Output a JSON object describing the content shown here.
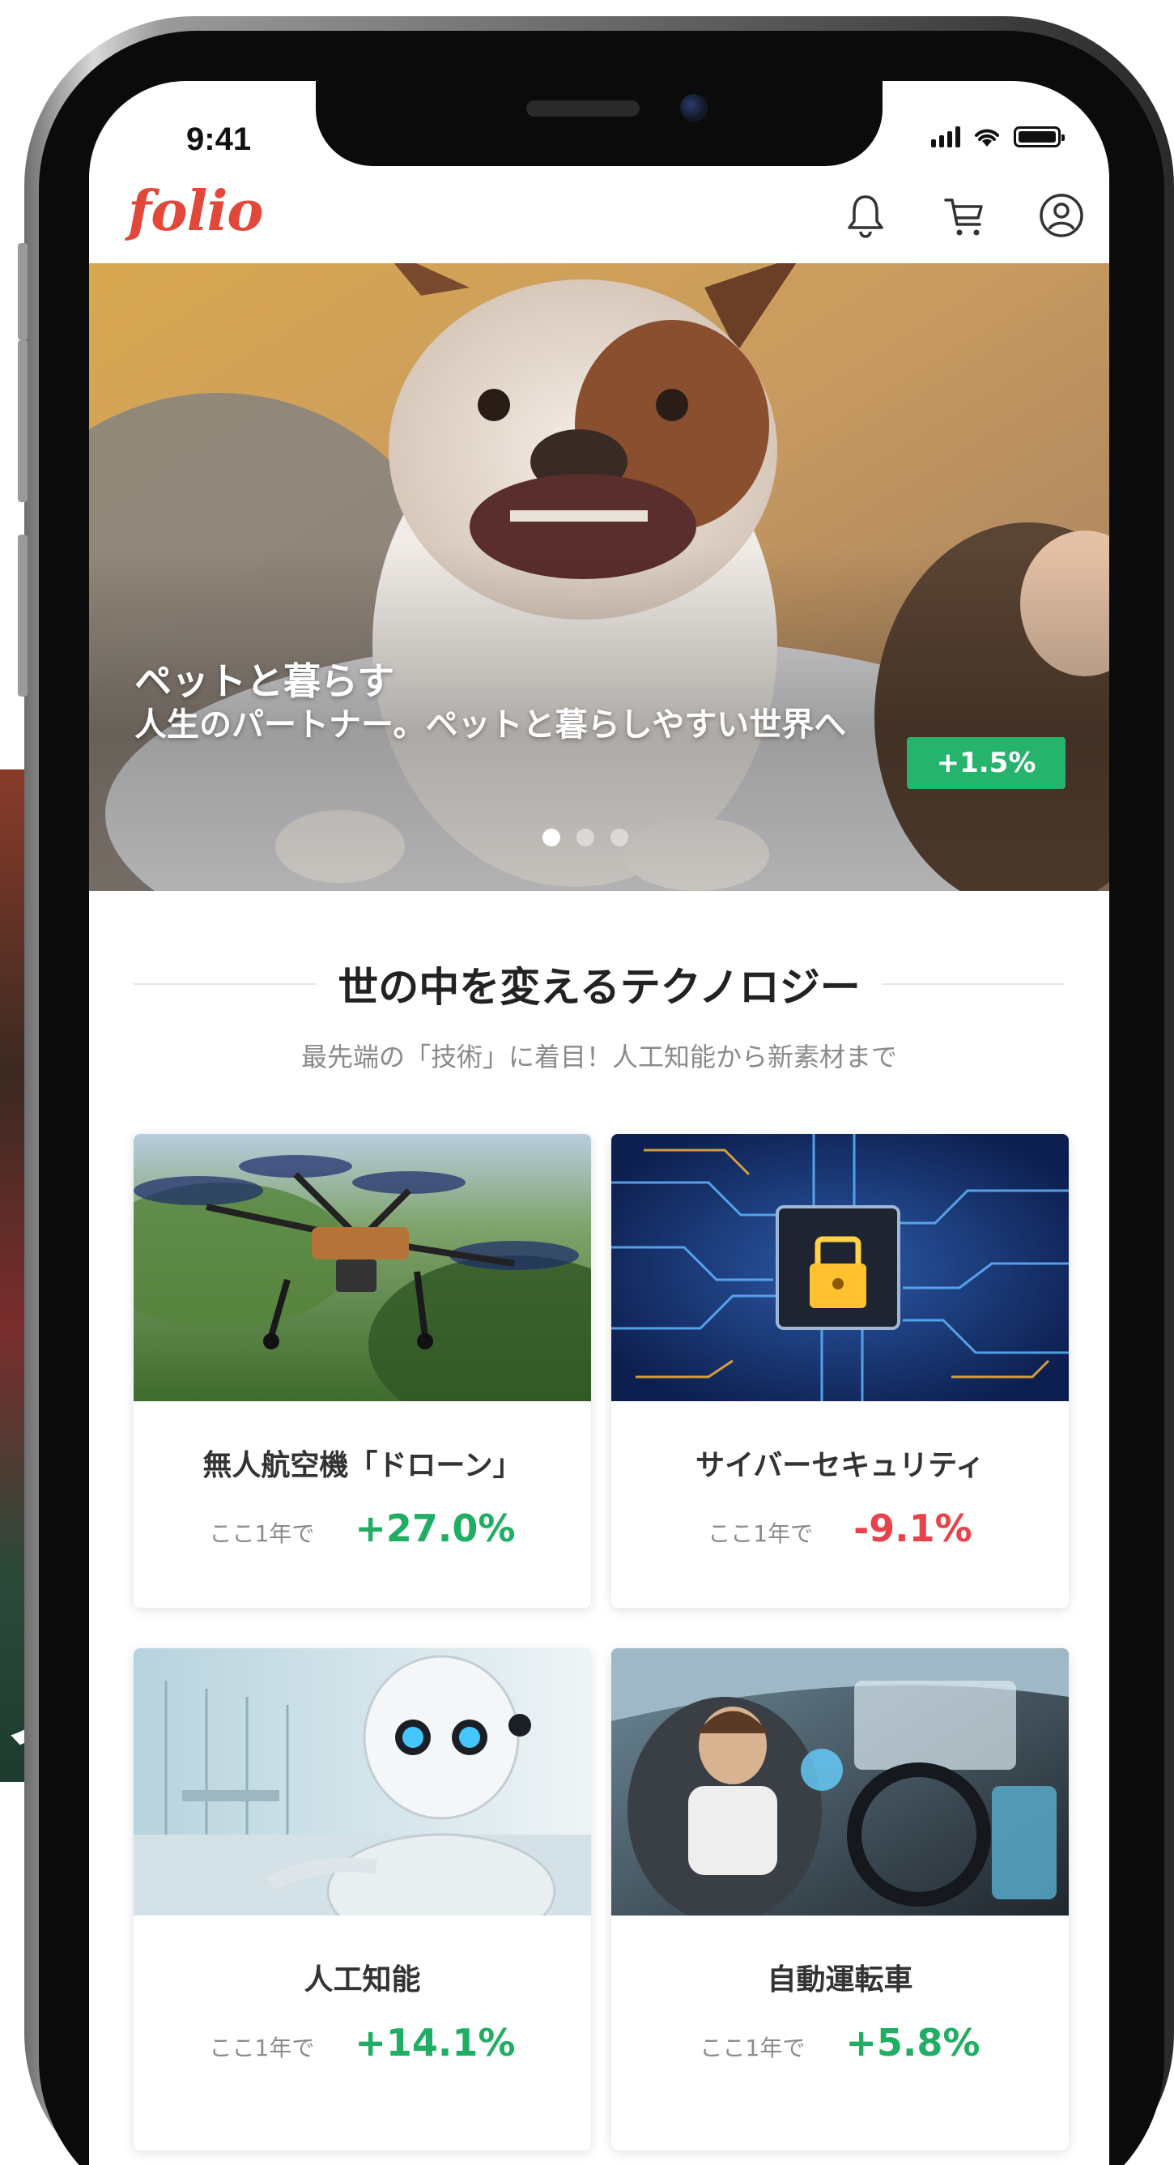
{
  "status_bar": {
    "time": "9:41"
  },
  "header": {
    "logo": "folio",
    "icons": [
      "bell-icon",
      "cart-icon",
      "account-icon"
    ]
  },
  "hero": {
    "title": "ペットと暮らす",
    "subtitle": "人生のパートナー。ペットと暮らしやすい世界へ",
    "badge": "+1.5%",
    "carousel": {
      "count": 3,
      "active": 1
    }
  },
  "section": {
    "title": "世の中を変えるテクノロジー",
    "subtitle": "最先端の「技術」に着目！人工知能から新素材まで"
  },
  "themes": [
    {
      "title": "無人航空機「ドローン」",
      "period": "ここ1年で",
      "return": "+27.0%",
      "trend": "up"
    },
    {
      "title": "サイバーセキュリティ",
      "period": "ここ1年で",
      "return": "-9.1%",
      "trend": "down"
    },
    {
      "title": "人工知能",
      "period": "ここ1年で",
      "return": "+14.1%",
      "trend": "up"
    },
    {
      "title": "自動運転車",
      "period": "ここ1年で",
      "return": "+5.8%",
      "trend": "up"
    }
  ],
  "colors": {
    "brand": "#e2483a",
    "positive": "#1fae63",
    "negative": "#e8434a",
    "badge": "#26b36b"
  },
  "background": {
    "poster_glyph": "ノ"
  }
}
